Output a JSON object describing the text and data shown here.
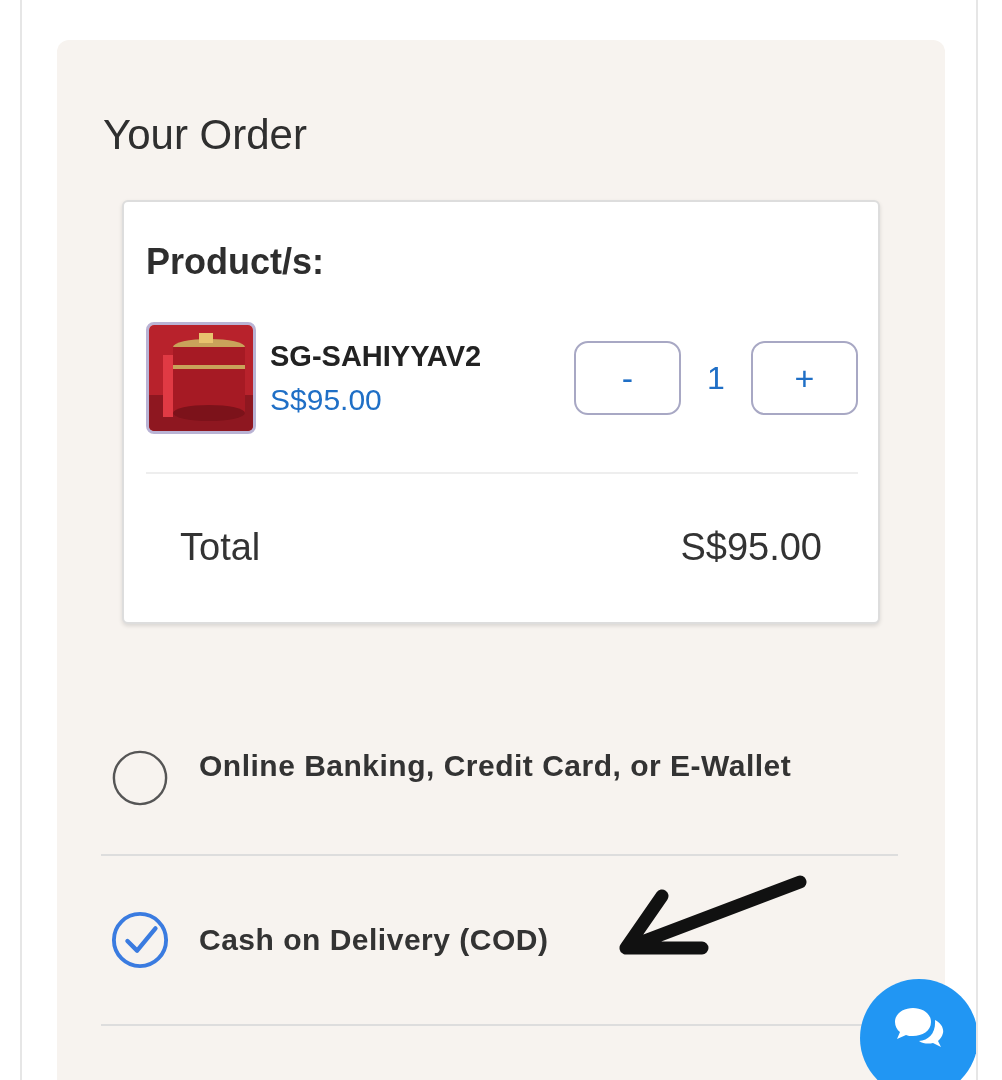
{
  "heading": "Your Order",
  "order_card": {
    "label": "Product/s:",
    "products": [
      {
        "kind": "picture",
        "name": "SG-SAHIYYAV2",
        "price": "S$95.00",
        "decrement": "-",
        "quantity": "1",
        "increment": "+"
      }
    ],
    "total_label": "Total",
    "total_value": "S$95.00"
  },
  "payment_options": [
    {
      "label": "Online Banking, Credit Card, or E-Wallet",
      "selected": false
    },
    {
      "label": "Cash on Delivery (COD)",
      "selected": true
    }
  ]
}
